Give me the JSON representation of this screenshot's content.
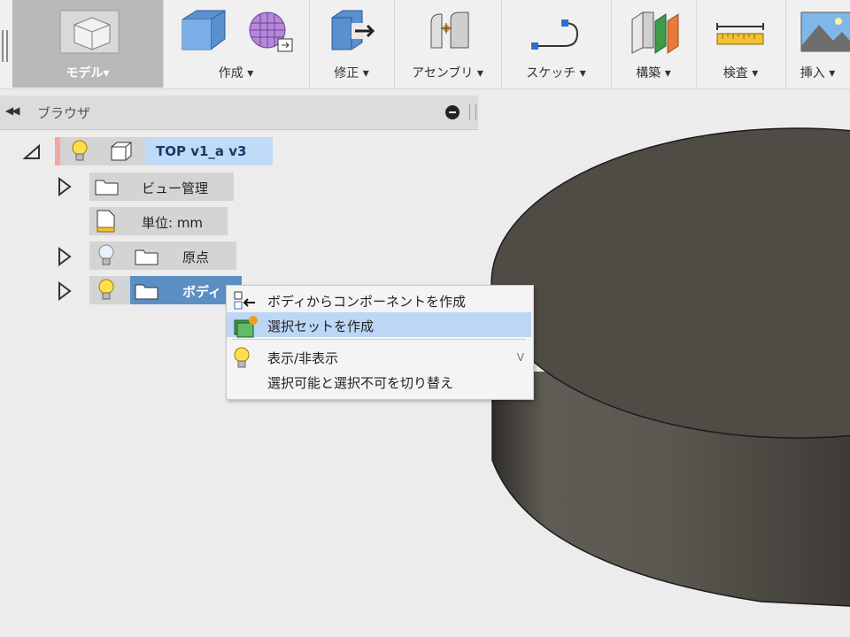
{
  "toolbar": {
    "groups": [
      {
        "label": "モデル▾",
        "icon": "model-workspace-icon"
      },
      {
        "label": "作成 ▾",
        "icon": "create-box-icon"
      },
      {
        "label": "修正 ▾",
        "icon": "modify-icon"
      },
      {
        "label": "アセンブリ ▾",
        "icon": "assembly-icon"
      },
      {
        "label": "スケッチ ▾",
        "icon": "sketch-icon"
      },
      {
        "label": "構築 ▾",
        "icon": "construct-icon"
      },
      {
        "label": "検査 ▾",
        "icon": "inspect-icon"
      },
      {
        "label": "挿入 ▾",
        "icon": "insert-icon"
      }
    ]
  },
  "browser": {
    "title": "ブラウザ",
    "root": {
      "label": "TOP v1_a v3"
    },
    "items": [
      {
        "label": "ビュー管理"
      },
      {
        "label": "単位: mm"
      },
      {
        "label": "原点"
      },
      {
        "label": "ボディ"
      }
    ]
  },
  "context_menu": {
    "items": [
      {
        "label": "ボディからコンポーネントを作成",
        "icon": "component-from-body-icon"
      },
      {
        "label": "選択セットを作成",
        "icon": "selection-set-icon",
        "highlighted": true
      },
      {
        "label": "表示/非表示",
        "icon": "lightbulb-icon",
        "shortcut": "V"
      },
      {
        "label": "選択可能と選択不可を切り替え",
        "icon": ""
      }
    ]
  },
  "colors": {
    "accent": "#5b8fc4",
    "menu_highlight": "#bcd7f5",
    "model_dark": "#4d4a44"
  }
}
